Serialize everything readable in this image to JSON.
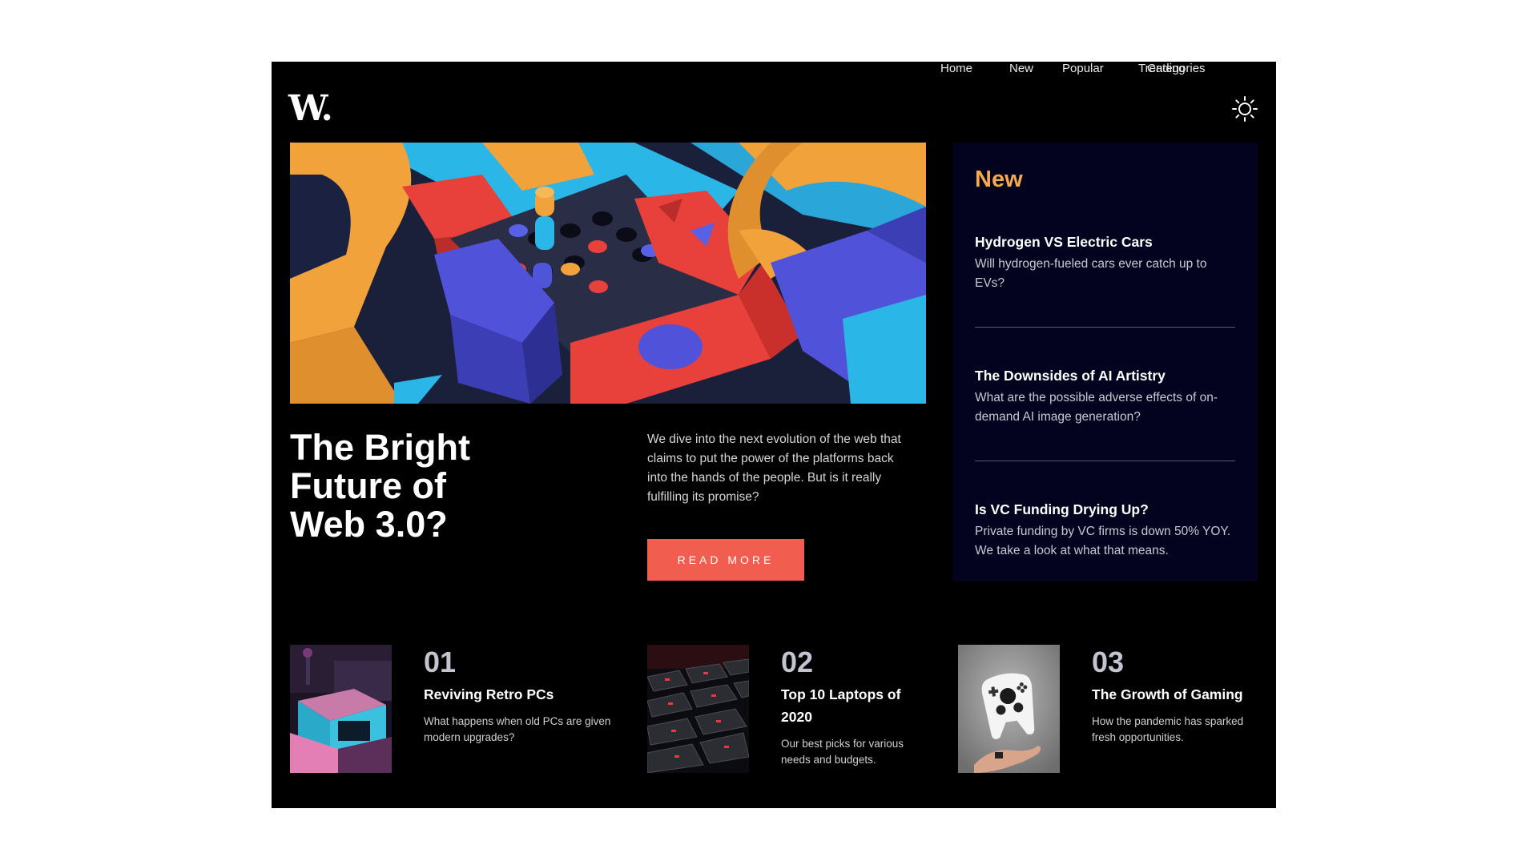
{
  "brand": {
    "logo_text": "W."
  },
  "nav": {
    "items": [
      "Home",
      "New",
      "Popular",
      "Trending",
      "Categories"
    ]
  },
  "theme_toggle": {
    "icon": "sun-icon"
  },
  "hero": {
    "title": "The Bright Future of Web 3.0?",
    "description": "We dive into the next evolution of the web that claims to put the power of the platforms back into the hands of the people. But is it really fulfilling its promise?",
    "button_label": "Read more"
  },
  "sidebar": {
    "title": "New",
    "articles": [
      {
        "title": "Hydrogen VS Electric Cars",
        "description": "Will hydrogen-fueled cars ever catch up to EVs?"
      },
      {
        "title": "The Downsides of AI Artistry",
        "description": "What are the possible adverse effects of on-demand AI image generation?"
      },
      {
        "title": "Is VC Funding Drying Up?",
        "description": "Private funding by VC firms is down 50% YOY. We take a look at what that means."
      }
    ]
  },
  "cards": [
    {
      "number": "01",
      "title": "Reviving Retro PCs",
      "description": "What happens when old PCs are given modern upgrades?"
    },
    {
      "number": "02",
      "title": "Top 10 Laptops of 2020",
      "description": "Our best picks for various needs and budgets."
    },
    {
      "number": "03",
      "title": "The Growth of Gaming",
      "description": "How the pandemic has sparked fresh opportunities."
    }
  ],
  "colors": {
    "accent_orange": "#f5a94a",
    "button_red": "#f15e50",
    "sidebar_bg": "#03031f",
    "page_bg": "#000000"
  }
}
